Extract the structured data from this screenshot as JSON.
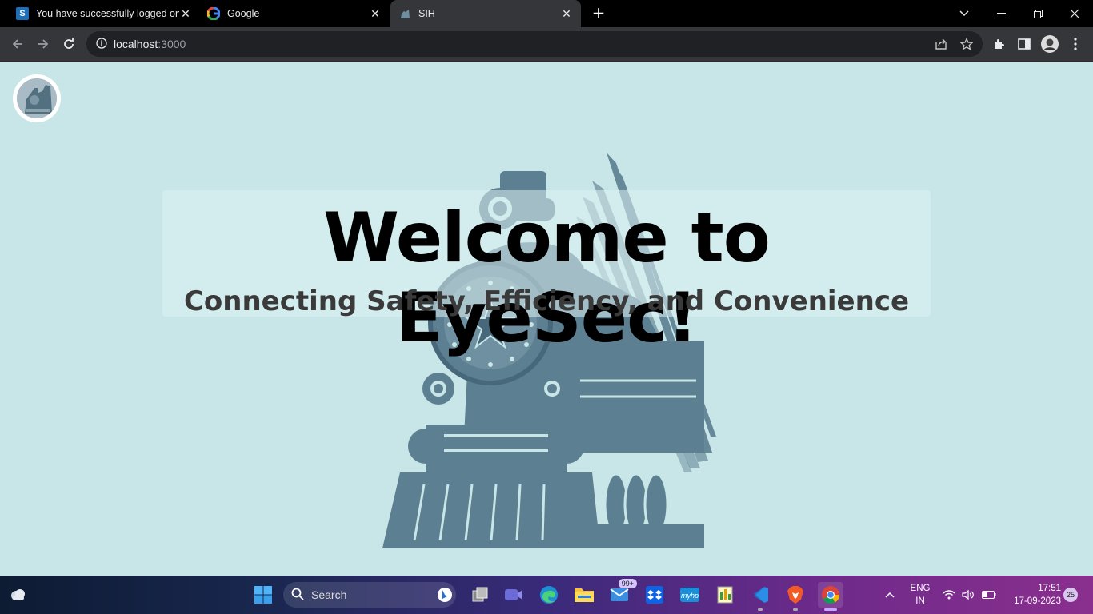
{
  "browser": {
    "tabs": [
      {
        "title": "You have successfully logged on.",
        "favicon": "s-logo-icon",
        "active": false
      },
      {
        "title": "Google",
        "favicon": "google-icon",
        "active": false
      },
      {
        "title": "SIH",
        "favicon": "train-icon",
        "active": true
      }
    ],
    "address": {
      "host": "localhost",
      "port": ":3000"
    }
  },
  "page": {
    "title": "Welcome to EyeSec!",
    "subtitle": "Connecting Safety, Efficiency, and Convenience",
    "colors": {
      "background": "#c8e6e7",
      "train": "#5c7f91"
    }
  },
  "taskbar": {
    "search_label": "Search",
    "mail_badge": "99+",
    "language": {
      "line1": "ENG",
      "line2": "IN"
    },
    "clock": {
      "time": "17:51",
      "date": "17-09-2023"
    },
    "notification_count": "25"
  }
}
